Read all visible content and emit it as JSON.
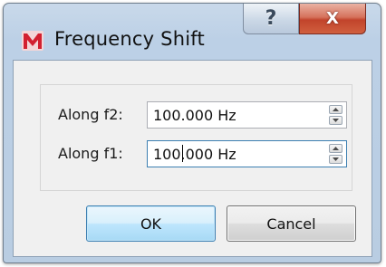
{
  "window": {
    "title": "Frequency Shift",
    "help_symbol": "?",
    "close_symbol": "X"
  },
  "form": {
    "rows": [
      {
        "label": "Along f2:",
        "value": "100.000 Hz"
      },
      {
        "label": "Along f1:",
        "value": "100.000 Hz"
      }
    ]
  },
  "buttons": {
    "ok_label": "OK",
    "cancel_label": "Cancel"
  },
  "icons": {
    "app": "app-logo-icon",
    "help": "help-icon",
    "close": "close-icon",
    "spin_up": "spin-up-icon",
    "spin_down": "spin-down-icon"
  },
  "colors": {
    "ok_border": "#3c7fb1",
    "close_button": "#c2432b",
    "app_icon": "#d22030"
  }
}
